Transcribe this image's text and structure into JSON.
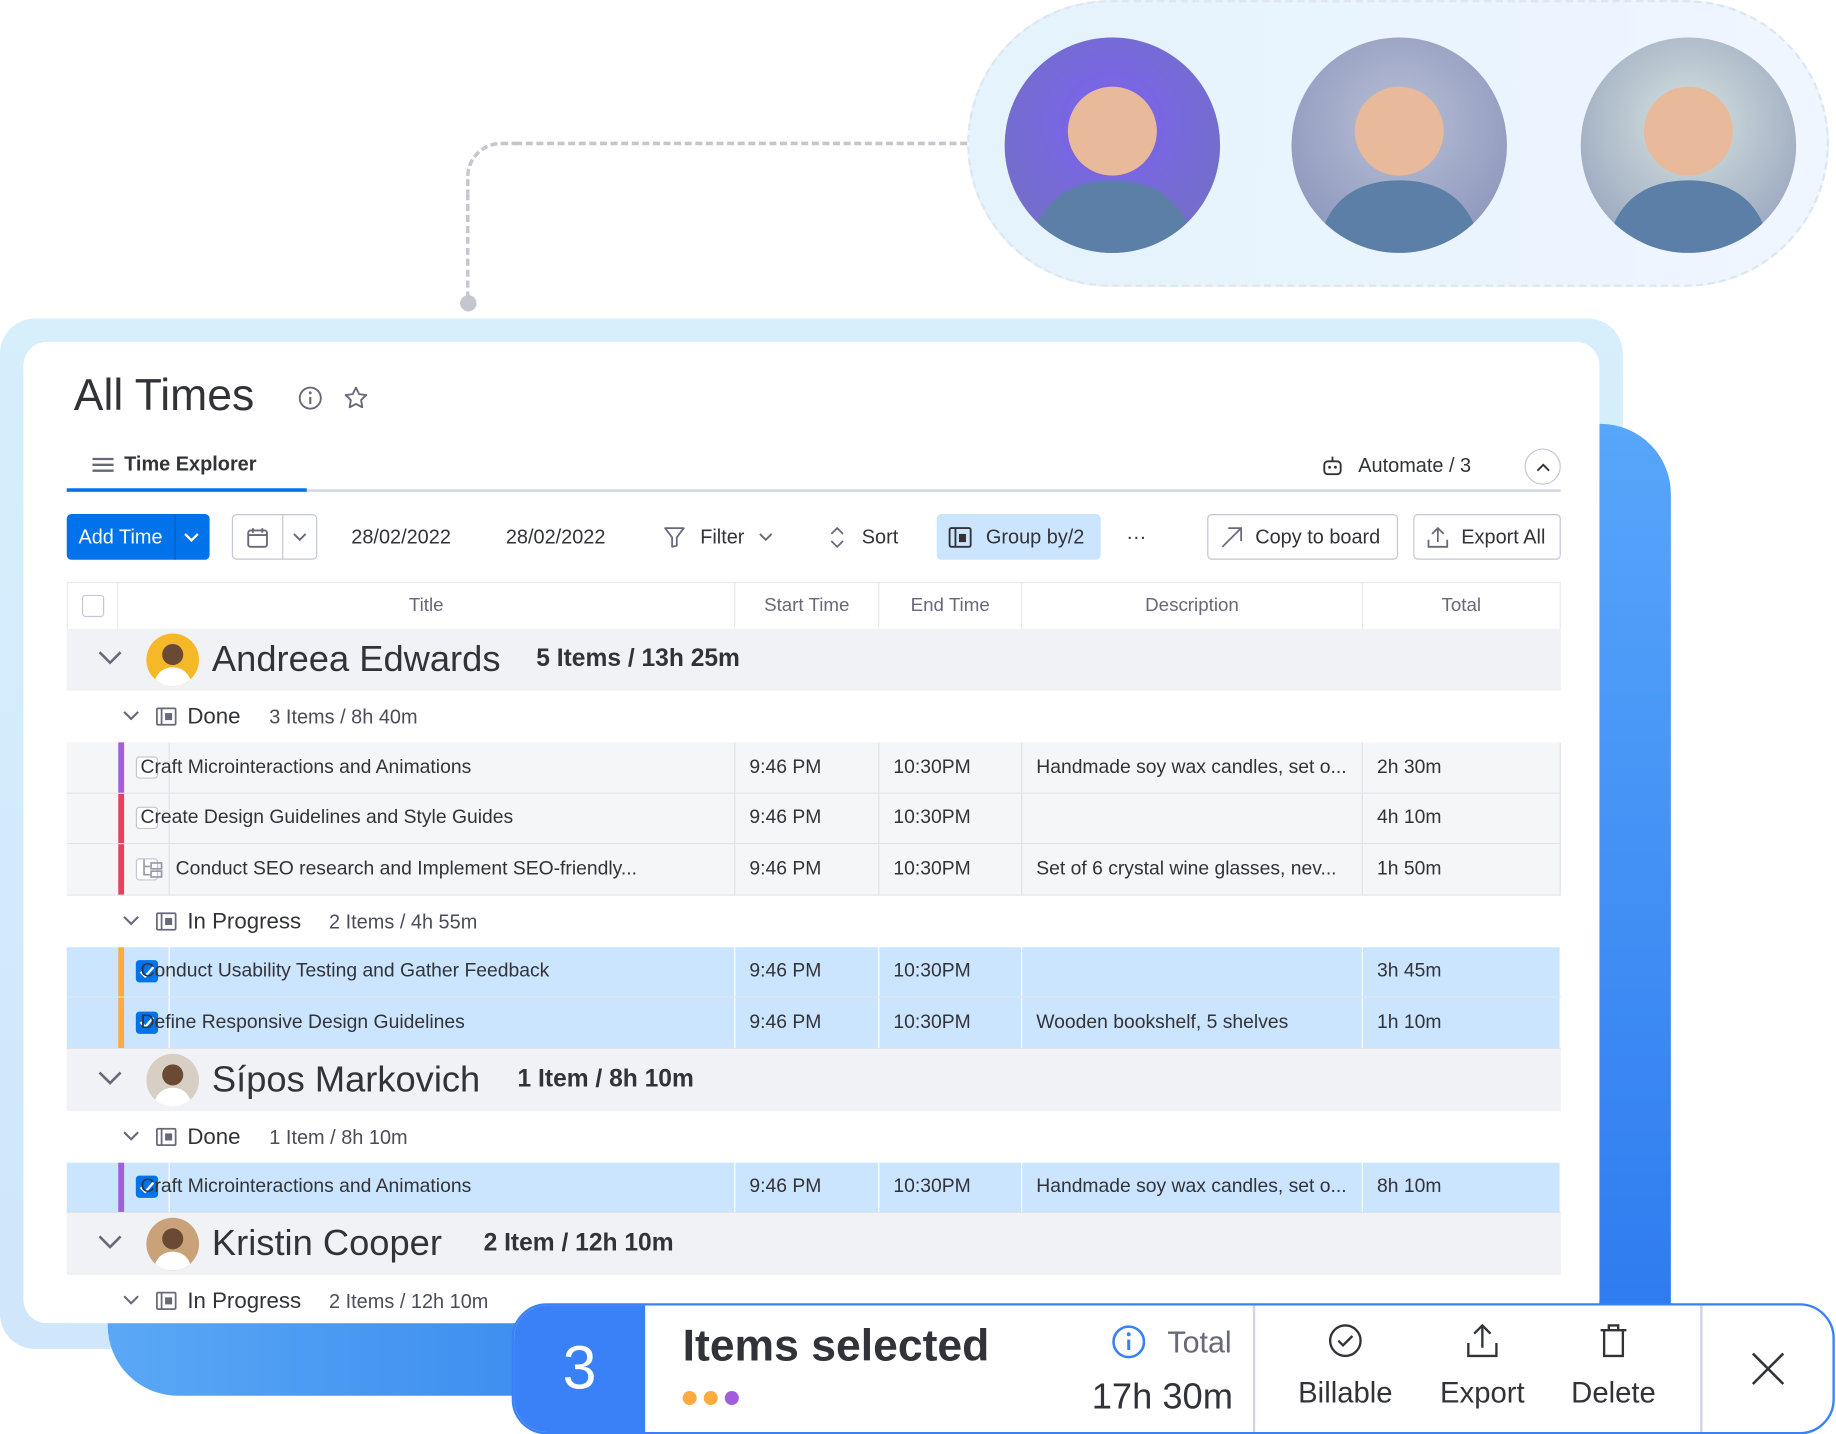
{
  "page": {
    "title": "All Times",
    "tab": "Time Explorer",
    "automate": "Automate / 3"
  },
  "toolbar": {
    "add_time": "Add Time",
    "date_from": "28/02/2022",
    "date_to": "28/02/2022",
    "filter": "Filter",
    "sort": "Sort",
    "group_by": "Group by/2",
    "more": "···",
    "copy": "Copy to board",
    "export_all": "Export All"
  },
  "columns": [
    "Title",
    "Start Time",
    "End Time",
    "Description",
    "Total"
  ],
  "groups": [
    {
      "name": "Andreea Edwards",
      "summary": "5 Items / 13h 25m",
      "avatar_color": "#f5b829",
      "subgroups": [
        {
          "status": "Done",
          "summary": "3 Items / 8h 40m",
          "items": [
            {
              "title": "Craft Microinteractions and Animations",
              "start": "9:46 PM",
              "end": "10:30PM",
              "description": "Handmade soy wax candles, set o...",
              "total": "2h 30m",
              "selected": false,
              "color": "#a25ddc"
            },
            {
              "title": "Create Design Guidelines and Style Guides",
              "start": "9:46 PM",
              "end": "10:30PM",
              "description": "",
              "total": "4h 10m",
              "selected": false,
              "color": "#e2445c"
            },
            {
              "title": "Conduct SEO research and Implement SEO-friendly...",
              "start": "9:46 PM",
              "end": "10:30PM",
              "description": "Set of 6 crystal wine glasses, nev...",
              "total": "1h 50m",
              "selected": false,
              "color": "#e2445c",
              "subitem": true
            }
          ]
        },
        {
          "status": "In Progress",
          "summary": "2 Items / 4h 55m",
          "items": [
            {
              "title": "Conduct Usability Testing and Gather Feedback",
              "start": "9:46 PM",
              "end": "10:30PM",
              "description": "",
              "total": "3h 45m",
              "selected": true,
              "color": "#fdab3d"
            },
            {
              "title": "Define Responsive Design Guidelines",
              "start": "9:46 PM",
              "end": "10:30PM",
              "description": "Wooden bookshelf, 5 shelves",
              "total": "1h 10m",
              "selected": true,
              "color": "#fdab3d"
            }
          ]
        }
      ]
    },
    {
      "name": "Sípos Markovich",
      "summary": "1 Item / 8h 10m",
      "avatar_color": "#d8cfc4",
      "subgroups": [
        {
          "status": "Done",
          "summary": "1 Item / 8h 10m",
          "items": [
            {
              "title": "Craft Microinteractions and Animations",
              "start": "9:46 PM",
              "end": "10:30PM",
              "description": "Handmade soy wax candles, set o...",
              "total": "8h 10m",
              "selected": true,
              "color": "#a25ddc"
            }
          ]
        }
      ]
    },
    {
      "name": "Kristin Cooper",
      "summary": "2 Item / 12h 10m",
      "avatar_color": "#c9a27a",
      "subgroups": [
        {
          "status": "In Progress",
          "summary": "2 Items / 12h 10m",
          "items": []
        }
      ]
    }
  ],
  "selection": {
    "count": "3",
    "label": "Items selected",
    "total_label": "Total",
    "total_value": "17h 30m",
    "dots": [
      "#fdab3d",
      "#fdab3d",
      "#a25ddc"
    ],
    "actions": [
      "Billable",
      "Export",
      "Delete"
    ]
  },
  "team_avatars": [
    {
      "bg": "#7b61f0"
    },
    {
      "bg": "#b8bfd6"
    },
    {
      "bg": "#d6e3df"
    }
  ]
}
